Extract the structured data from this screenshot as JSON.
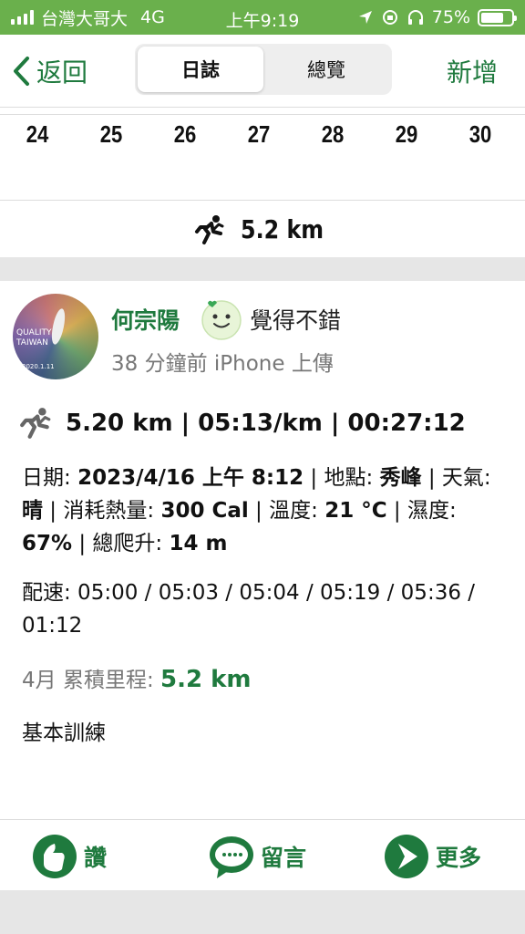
{
  "status_bar": {
    "carrier": "台灣大哥大",
    "network": "4G",
    "time": "上午9:19",
    "battery": "75%",
    "battery_level": 0.75
  },
  "nav": {
    "back_label": "返回",
    "tabs": [
      {
        "label": "日誌",
        "active": true
      },
      {
        "label": "總覽",
        "active": false
      }
    ],
    "add_label": "新增"
  },
  "week": {
    "days": [
      "24",
      "25",
      "26",
      "27",
      "28",
      "29",
      "30"
    ],
    "distance": "5.2 km"
  },
  "post": {
    "user_name": "何宗陽",
    "mood": "覺得不錯",
    "meta": "38 分鐘前 iPhone 上傳",
    "avatar_text": [
      "QUALITY",
      "TAIWAN"
    ],
    "avatar_date": "2020.1.11",
    "stats": "5.20 km | 05:13/km | 00:27:12",
    "details": {
      "date_label": "日期: ",
      "date_value": "2023/4/16 上午 8:12",
      "location_label": " | 地點: ",
      "location_value": "秀峰",
      "weather_label": " | 天氣: ",
      "weather_value": "晴",
      "calories_label": " | 消耗熱量: ",
      "calories_value": "300 Cal",
      "temp_label": " | 溫度: ",
      "temp_value": "21 °C",
      "humidity_label": " | 濕度: ",
      "humidity_value": "67%",
      "climb_label": " | 總爬升: ",
      "climb_value": "14 m"
    },
    "pace_text": "配速: 05:00 / 05:03 / 05:04 / 05:19 / 05:36 / 01:12",
    "month_label": "4月 累積里程: ",
    "month_value": "5.2 km",
    "note": "基本訓練"
  },
  "actions": {
    "like": "讚",
    "comment": "留言",
    "more": "更多"
  },
  "colors": {
    "status_green": "#6ab04c",
    "brand_green": "#1f7a3e"
  }
}
